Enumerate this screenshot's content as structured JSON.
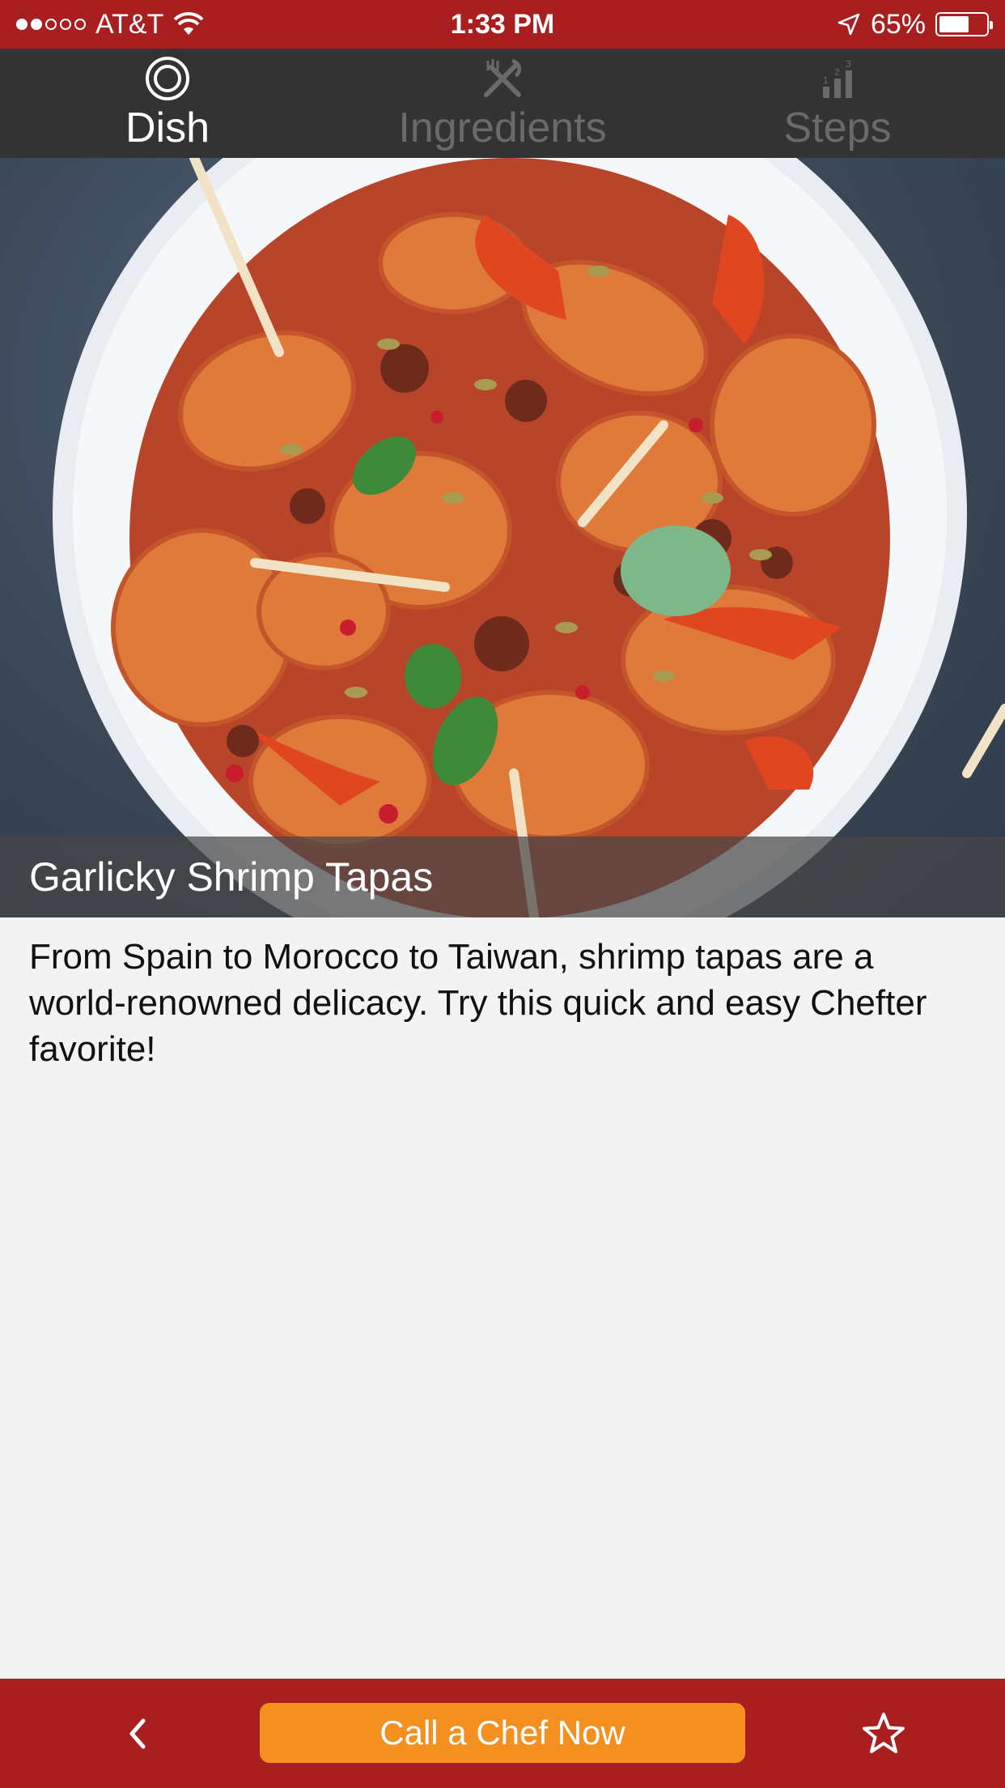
{
  "status_bar": {
    "carrier": "AT&T",
    "time": "1:33 PM",
    "battery": "65%",
    "battery_level": 0.65,
    "signal_bars_filled": 2,
    "signal_bars_total": 5
  },
  "tabs": [
    {
      "label": "Dish",
      "icon": "plate-icon",
      "active": true
    },
    {
      "label": "Ingredients",
      "icon": "fork-knife-icon",
      "active": false
    },
    {
      "label": "Steps",
      "icon": "steps-icon",
      "active": false
    }
  ],
  "dish": {
    "title": "Garlicky Shrimp Tapas",
    "description": "From Spain to Morocco to Taiwan, shrimp tapas are a world-renowned delicacy. Try this quick and easy Chefter favorite!"
  },
  "bottom_bar": {
    "cta_label": "Call a Chef Now",
    "back_icon": "chevron-left-icon",
    "favorite_icon": "star-outline-icon"
  },
  "colors": {
    "brand_red": "#a91e1f",
    "tab_bg": "#333333",
    "cta_orange": "#f39020",
    "inactive_tab": "#6a6a6a"
  }
}
